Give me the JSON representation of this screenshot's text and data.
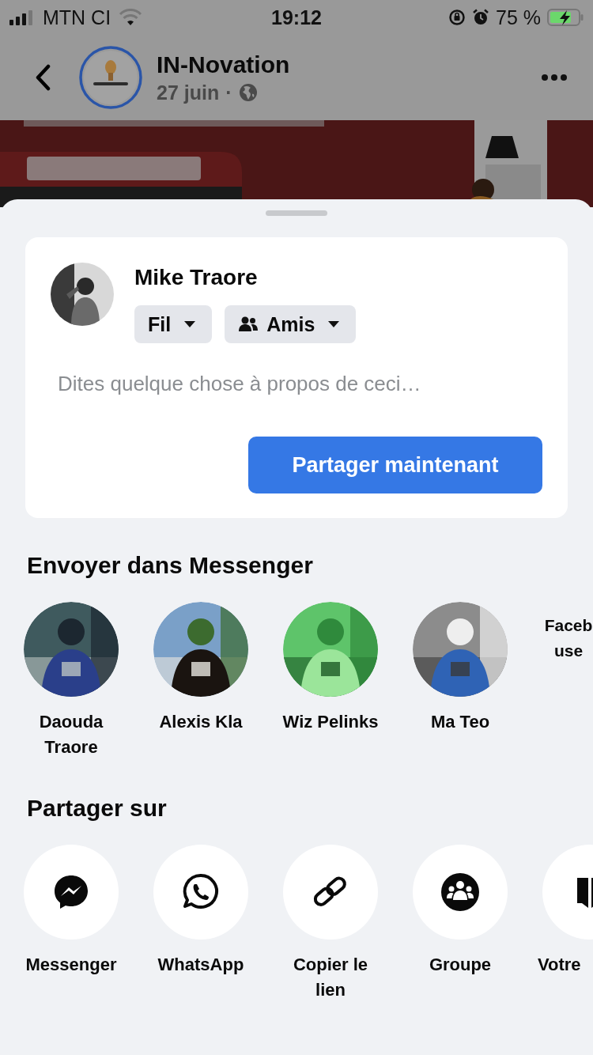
{
  "status_bar": {
    "carrier": "MTN CI",
    "time": "19:12",
    "battery": "75 %"
  },
  "post_header": {
    "page_name": "IN-Novation",
    "date": "27 juin",
    "separator": "·"
  },
  "share_card": {
    "user_name": "Mike Traore",
    "audience_chips": [
      {
        "label": "Fil",
        "kind": "plain"
      },
      {
        "label": "Amis",
        "kind": "friends"
      }
    ],
    "placeholder": "Dites quelque chose à propos de ceci…",
    "button": "Partager maintenant"
  },
  "messenger": {
    "title": "Envoyer dans Messenger",
    "contacts": [
      {
        "name": "Daouda Traore",
        "kind": "picture"
      },
      {
        "name": "Alexis Kla",
        "kind": "picture"
      },
      {
        "name": "Wiz Pelinks",
        "kind": "picture"
      },
      {
        "name": "Ma Teo",
        "kind": "picture"
      },
      {
        "name": "Faceb use",
        "kind": "text"
      }
    ]
  },
  "share_on": {
    "title": "Partager sur",
    "options": [
      {
        "label": "Messenger",
        "kind": "messenger"
      },
      {
        "label": "WhatsApp",
        "kind": "whatsapp"
      },
      {
        "label": "Copier le lien",
        "kind": "link"
      },
      {
        "label": "Groupe",
        "kind": "group"
      },
      {
        "label": "Votre",
        "kind": "book"
      }
    ]
  }
}
